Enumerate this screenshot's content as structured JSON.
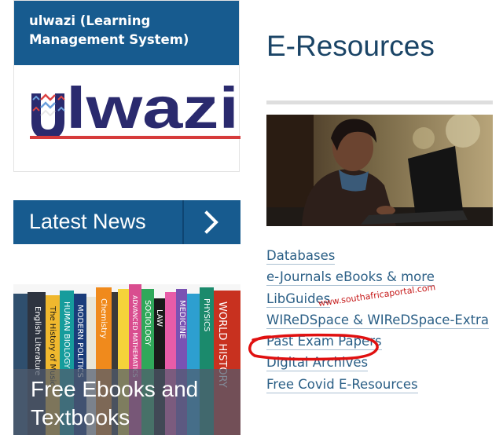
{
  "ulwazi": {
    "header": "ulwazi (Learning Management System)",
    "logo_text": "ulwazi"
  },
  "news": {
    "label": "Latest News"
  },
  "ebooks": {
    "title": "Free Ebooks and Textbooks",
    "spines": [
      "English Literature",
      "The History of Music",
      "HUMAN BIOLOGY",
      "MODERN POLITICS",
      "Chemistry",
      "ADVANCED MATHEMATICS",
      "SOCIOLOGY",
      "LAW",
      "MEDICINE",
      "PHYSICS",
      "WORLD HISTORY"
    ]
  },
  "eresources": {
    "title": "E-Resources",
    "links": [
      "Databases",
      "e-Journals eBooks & more",
      "LibGuides",
      "WIReDSpace & WIReDSpace-Extra",
      "Past Exam Papers",
      "Digital Archives",
      "Free Covid E-Resources"
    ]
  },
  "watermark": "www.southafricaportal.com",
  "colors": {
    "brand_blue": "#175b8f",
    "link_blue": "#2b5f86",
    "title_navy": "#1a4466",
    "annotation_red": "#e01010"
  },
  "icons": {
    "news_arrow": "chevron-right-icon"
  }
}
